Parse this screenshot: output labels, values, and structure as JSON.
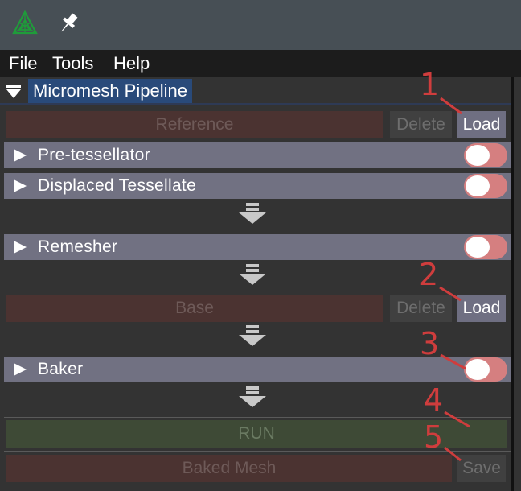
{
  "menu": [
    "File",
    "Tools",
    "Help"
  ],
  "panel": {
    "title": "Micromesh Pipeline"
  },
  "reference": {
    "label": "Reference",
    "delete": "Delete",
    "load": "Load"
  },
  "stages": {
    "pretess": {
      "label": "Pre-tessellator",
      "enabled": false
    },
    "displaced": {
      "label": "Displaced Tessellate",
      "enabled": false
    },
    "remesher": {
      "label": "Remesher",
      "enabled": false
    },
    "baker": {
      "label": "Baker",
      "enabled": false
    }
  },
  "base": {
    "label": "Base",
    "delete": "Delete",
    "load": "Load"
  },
  "run": {
    "label": "RUN"
  },
  "baked": {
    "label": "Baked Mesh",
    "save": "Save"
  },
  "annotations": [
    "1",
    "2",
    "3",
    "4",
    "5"
  ],
  "colors": {
    "titlebar": "#474f55",
    "panel_title_bg": "#294a7a",
    "stage_bg": "#717182",
    "toggle_off": "#d57f80",
    "slot_bg": "#4b3331",
    "run_bg": "#3e4a36",
    "annotation": "#cf3d3d",
    "app_icon": "#1f9c3a"
  },
  "icons": {
    "app": "triangle-mesh-icon",
    "pin": "pin-icon",
    "expand": "caret-right-icon",
    "collapse": "caret-down-icon",
    "flow": "down-arrow-icon"
  }
}
